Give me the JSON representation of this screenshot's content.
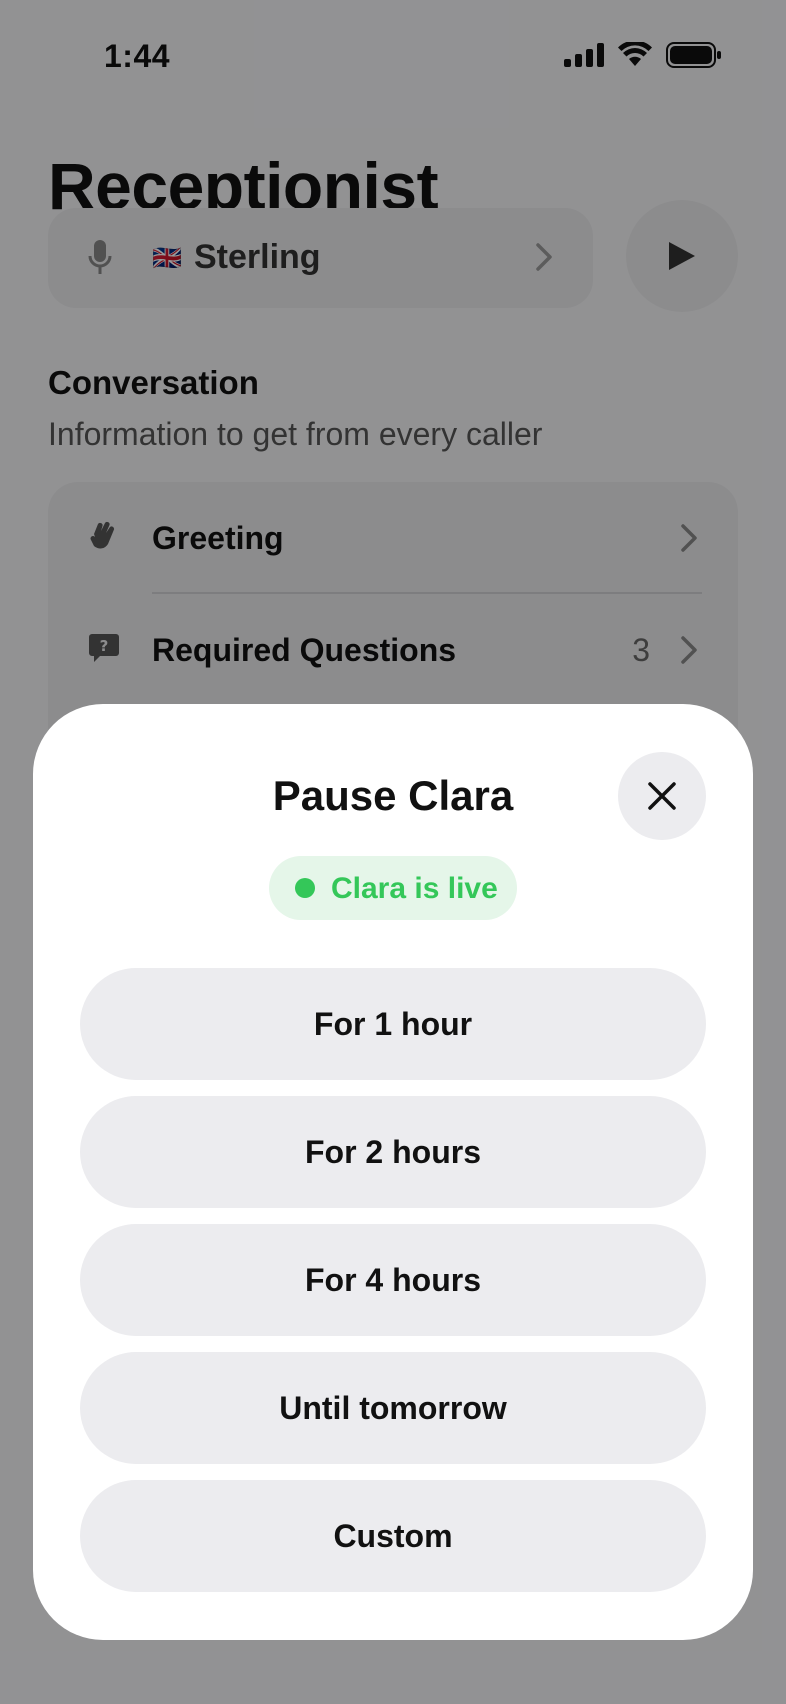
{
  "status_bar": {
    "time": "1:44",
    "icons": [
      "signal-icon",
      "wifi-icon",
      "battery-icon"
    ]
  },
  "page": {
    "title": "Receptionist",
    "voice": {
      "flag": "🇬🇧",
      "name": "Sterling"
    },
    "conversation": {
      "title": "Conversation",
      "subtitle": "Information to get from every caller",
      "items": [
        {
          "label": "Greeting",
          "icon": "wave-hand-icon",
          "count": ""
        },
        {
          "label": "Required Questions",
          "icon": "question-bubble-icon",
          "count": "3"
        }
      ]
    }
  },
  "sheet": {
    "title": "Pause Clara",
    "status": "Clara is live",
    "status_color": "#34c759",
    "options": [
      "For 1 hour",
      "For 2 hours",
      "For 4 hours",
      "Until tomorrow",
      "Custom"
    ]
  }
}
